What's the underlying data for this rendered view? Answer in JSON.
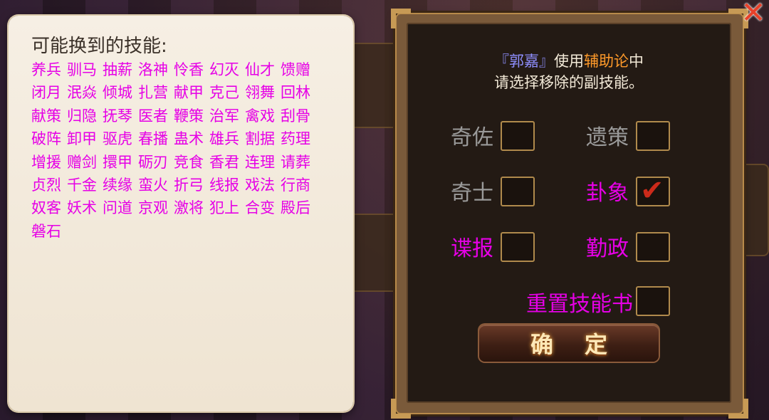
{
  "left": {
    "title": "可能换到的技能:",
    "skills": [
      "养兵",
      "驯马",
      "抽薪",
      "洛神",
      "怜香",
      "幻灭",
      "仙才",
      "馈赠",
      "闭月",
      "泯焱",
      "倾城",
      "扎营",
      "献甲",
      "克己",
      "翎舞",
      "回林",
      "献策",
      "归隐",
      "抚琴",
      "医者",
      "鞭策",
      "治军",
      "禽戏",
      "刮骨",
      "破阵",
      "卸甲",
      "驱虎",
      "春播",
      "蛊术",
      "雄兵",
      "割据",
      "药理",
      "增援",
      "赠剑",
      "擐甲",
      "砺刃",
      "竞食",
      "香君",
      "连理",
      "请葬",
      "贞烈",
      "千金",
      "续缘",
      "蛮火",
      "折弓",
      "线报",
      "戏法",
      "行商",
      "奴客",
      "妖术",
      "问道",
      "京观",
      "激将",
      "犯上",
      "合变",
      "殿后",
      "磐石"
    ]
  },
  "dialog": {
    "hero": "『郭嘉』",
    "use_text": "使用",
    "item": "辅助论",
    "middle": "中",
    "instruction": "请选择移除的副技能。",
    "options": [
      {
        "label": "奇佐",
        "checked": false,
        "color": "grey"
      },
      {
        "label": "遗策",
        "checked": false,
        "color": "grey"
      },
      {
        "label": "奇士",
        "checked": false,
        "color": "grey"
      },
      {
        "label": "卦象",
        "checked": true,
        "color": "magenta"
      },
      {
        "label": "谍报",
        "checked": false,
        "color": "magenta"
      },
      {
        "label": "勤政",
        "checked": false,
        "color": "magenta"
      },
      {
        "label": "重置技能书",
        "checked": false,
        "color": "magenta"
      }
    ],
    "confirm_label": "确定",
    "checkmark": "✔"
  },
  "colors": {
    "skill_magenta": "#e600e6",
    "hero_blue": "#8f8fff",
    "item_orange": "#ff9a2a",
    "option_grey": "#9a9a9a",
    "check_red": "#cc2a1a"
  },
  "icons": {
    "close": "close-icon",
    "check": "checkmark-icon"
  }
}
